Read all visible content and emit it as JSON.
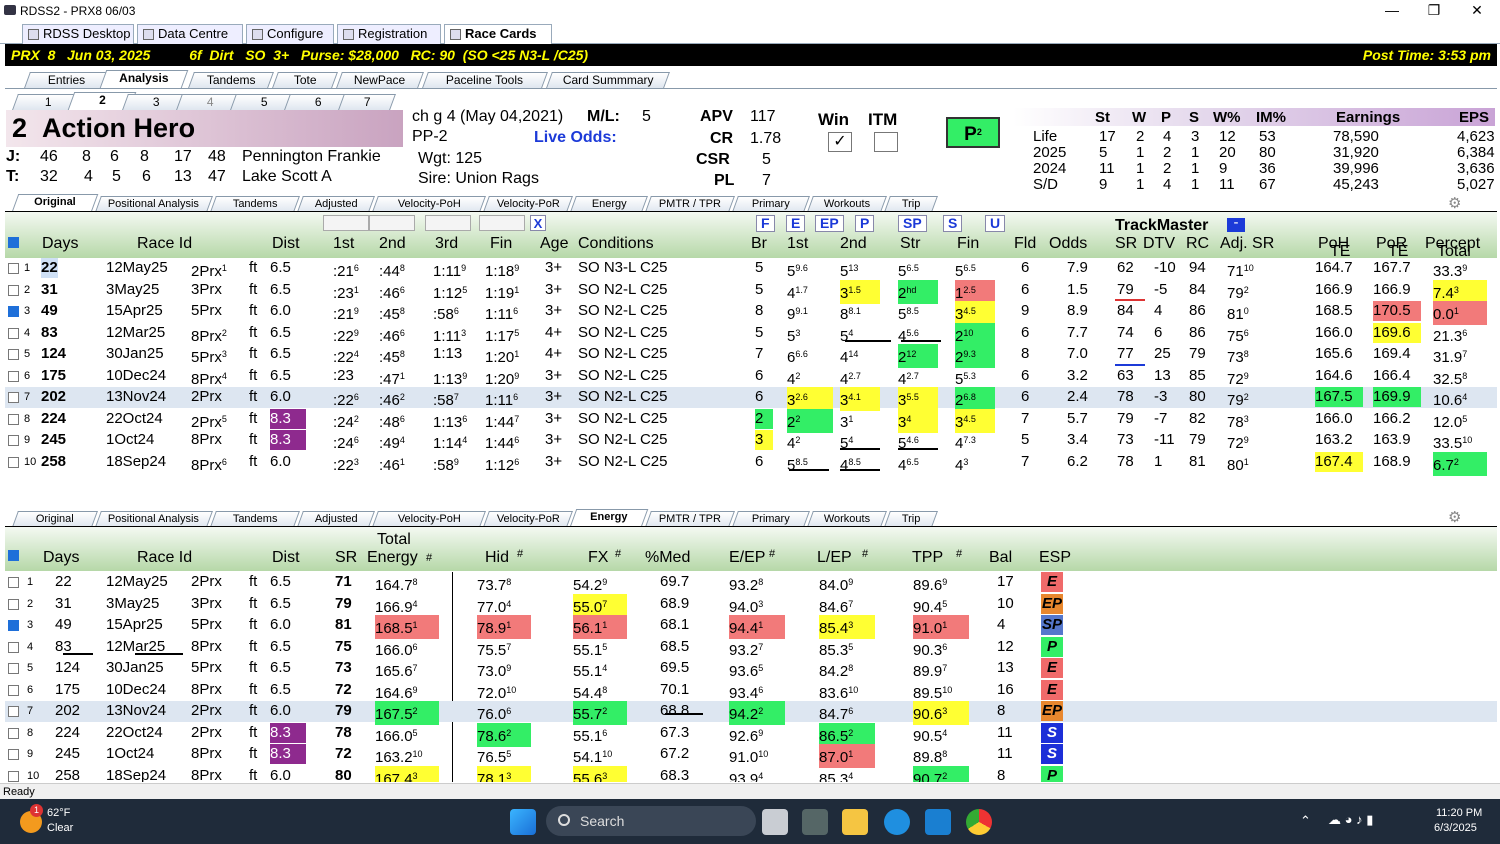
{
  "window": {
    "title": "RDSS2 - PRX8  06/03"
  },
  "apptabs": [
    "RDSS Desktop",
    "Data Centre",
    "Configure",
    "Registration",
    "Race Cards"
  ],
  "race": {
    "left": "PRX  8   Jun 03, 2025          6f  Dirt   SO  3+   Purse: $28,000   RC: 90  (SO <25 N3-L /C25)",
    "right": "Post Time: 3:53 pm"
  },
  "subtabs": [
    "Entries",
    "Analysis",
    "Tandems",
    "Tote",
    "NewPace",
    "Paceline Tools",
    "Card Summmary"
  ],
  "horsetabs": [
    "1",
    "2",
    "3",
    "4",
    "5",
    "6",
    "7"
  ],
  "horse": {
    "num": "2",
    "name": "Action Hero",
    "desc": "ch g 4 (May 04,2021)",
    "pp": "PP-2",
    "wgt": "Wgt: 125",
    "sire": "Sire: Union Rags",
    "ml_label": "M/L:",
    "ml": "5",
    "live": "Live Odds:",
    "j_label": "J:",
    "j": [
      "46",
      "8",
      "6",
      "8",
      "17",
      "48"
    ],
    "jname": "Pennington Frankie",
    "t_label": "T:",
    "t": [
      "32",
      "4",
      "5",
      "6",
      "13",
      "47"
    ],
    "tname": "Lake Scott A",
    "apv_l": "APV",
    "apv": "117",
    "cr_l": "CR",
    "cr": "1.78",
    "csr_l": "CSR",
    "csr": "5",
    "pl_l": "PL",
    "pl": "7",
    "win": "Win",
    "itm": "ITM",
    "badge": "P",
    "badge_sup": "2"
  },
  "career": {
    "headers": [
      "St",
      "W",
      "P",
      "S",
      "W%",
      "IM%",
      "Earnings",
      "EPS"
    ],
    "rows": [
      [
        "Life",
        "17",
        "2",
        "4",
        "3",
        "12",
        "53",
        "78,590",
        "4,623"
      ],
      [
        "2025",
        "5",
        "1",
        "2",
        "1",
        "20",
        "80",
        "31,920",
        "6,384"
      ],
      [
        "2024",
        "11",
        "1",
        "2",
        "1",
        "9",
        "36",
        "39,996",
        "3,636"
      ],
      [
        "S/D",
        "9",
        "1",
        "4",
        "1",
        "11",
        "67",
        "45,243",
        "5,027"
      ]
    ]
  },
  "tabs1": [
    "Original",
    "Positional Analysis",
    "Tandems",
    "Adjusted",
    "Velocity-PoH",
    "Velocity-PoR",
    "Energy",
    "PMTR / TPR",
    "Primary",
    "Workouts",
    "Trip"
  ],
  "grid1": {
    "headers": {
      "days": "Days",
      "race": "Race Id",
      "dist": "Dist",
      "c1": "1st",
      "c2": "2nd",
      "c3": "3rd",
      "fin": "Fin",
      "age": "Age",
      "cond": "Conditions",
      "br": "Br",
      "p1": "1st",
      "p2": "2nd",
      "str": "Str",
      "pfin": "Fin",
      "fld": "Fld",
      "odds": "Odds",
      "tm": "TrackMaster",
      "sr": "SR",
      "dtv": "DTV",
      "rc": "RC",
      "adj": "Adj. SR",
      "poh": "PoH",
      "poh2": "TE",
      "por": "PoR",
      "por2": "TE",
      "pct": "Percept",
      "pct2": "Total",
      "x": "X",
      "pace": [
        "F",
        "E",
        "EP",
        "P",
        "SP",
        "S",
        "U"
      ]
    },
    "rows": [
      [
        "1",
        "22",
        "12May25",
        "2Prx",
        "1",
        "ft",
        "6.5",
        ":21",
        "6",
        ":44",
        "8",
        "1:11",
        "9",
        "1:18",
        "9",
        "3+",
        "SO N3-L C25",
        "5",
        "5",
        "9.6",
        "5",
        "13",
        "5",
        "6.5",
        "5",
        "6.5",
        "6",
        "7.9",
        "62",
        "-10",
        "94",
        "71",
        "10",
        "164.7",
        "167.7",
        "33.3",
        "9"
      ],
      [
        "2",
        "31",
        "3May25",
        "3Prx",
        "",
        "ft",
        "6.5",
        ":23",
        "1",
        ":46",
        "6",
        "1:12",
        "5",
        "1:19",
        "1",
        "3+",
        "SO N2-L C25",
        "5",
        "4",
        "1.7",
        "3",
        "1.5",
        "2",
        "hd",
        "1",
        "2.5",
        "6",
        "1.5",
        "79",
        "-5",
        "84",
        "79",
        "2",
        "166.9",
        "166.9",
        "7.4",
        "3"
      ],
      [
        "3",
        "49",
        "15Apr25",
        "5Prx",
        "",
        "ft",
        "6.0",
        ":21",
        "9",
        ":45",
        "8",
        ":58",
        "6",
        "1:11",
        "6",
        "3+",
        "SO N2-L C25",
        "8",
        "9",
        "9.1",
        "8",
        "8.1",
        "5",
        "8.5",
        "3",
        "4.5",
        "9",
        "8.9",
        "84",
        "4",
        "86",
        "81",
        "0",
        "168.5",
        "170.5",
        "0.0",
        "1"
      ],
      [
        "4",
        "83",
        "12Mar25",
        "8Prx",
        "2",
        "ft",
        "6.5",
        ":22",
        "9",
        ":46",
        "6",
        "1:11",
        "3",
        "1:17",
        "5",
        "4+",
        "SO N2-L C25",
        "5",
        "5",
        "3",
        "5",
        "4",
        "4",
        "5.6",
        "2",
        "10",
        "6",
        "7.7",
        "74",
        "6",
        "86",
        "75",
        "6",
        "166.0",
        "169.6",
        "21.3",
        "6"
      ],
      [
        "5",
        "124",
        "30Jan25",
        "5Prx",
        "3",
        "ft",
        "6.5",
        ":22",
        "4",
        ":45",
        "8",
        "1:13",
        "",
        "1:20",
        "1",
        "4+",
        "SO N2-L C25",
        "7",
        "6",
        "6.6",
        "4",
        "14",
        "2",
        "12",
        "2",
        "9.3",
        "8",
        "7.0",
        "77",
        "25",
        "79",
        "73",
        "8",
        "165.6",
        "169.4",
        "31.9",
        "7"
      ],
      [
        "6",
        "175",
        "10Dec24",
        "8Prx",
        "4",
        "ft",
        "6.5",
        ":23",
        "",
        ":47",
        "1",
        "1:13",
        "9",
        "1:20",
        "9",
        "3+",
        "SO N2-L C25",
        "6",
        "4",
        "2",
        "4",
        "2.7",
        "4",
        "2.7",
        "5",
        "5.3",
        "6",
        "3.2",
        "63",
        "13",
        "85",
        "72",
        "9",
        "164.6",
        "166.4",
        "32.5",
        "8"
      ],
      [
        "7",
        "202",
        "13Nov24",
        "2Prx",
        "",
        "ft",
        "6.0",
        ":22",
        "6",
        ":46",
        "2",
        ":58",
        "7",
        "1:11",
        "6",
        "3+",
        "SO N2-L C25",
        "6",
        "3",
        "2.6",
        "3",
        "4.1",
        "3",
        "5.5",
        "2",
        "6.8",
        "6",
        "2.4",
        "78",
        "-3",
        "80",
        "79",
        "2",
        "167.5",
        "169.9",
        "10.6",
        "4"
      ],
      [
        "8",
        "224",
        "22Oct24",
        "2Prx",
        "5",
        "ft",
        "8.3",
        ":24",
        "2",
        ":48",
        "6",
        "1:13",
        "6",
        "1:44",
        "7",
        "3+",
        "SO N2-L C25",
        "2",
        "2",
        "2",
        "3",
        "1",
        "3",
        "4",
        "3",
        "4.5",
        "7",
        "5.7",
        "79",
        "-7",
        "82",
        "78",
        "3",
        "166.0",
        "166.2",
        "12.0",
        "5"
      ],
      [
        "9",
        "245",
        "1Oct24",
        "8Prx",
        "",
        "ft",
        "8.3",
        ":24",
        "6",
        ":49",
        "4",
        "1:14",
        "4",
        "1:44",
        "6",
        "3+",
        "SO N2-L C25",
        "3",
        "4",
        "2",
        "5",
        "4",
        "5",
        "4.6",
        "4",
        "7.3",
        "5",
        "3.4",
        "73",
        "-11",
        "79",
        "72",
        "9",
        "163.2",
        "163.9",
        "33.5",
        "10"
      ],
      [
        "10",
        "258",
        "18Sep24",
        "8Prx",
        "6",
        "ft",
        "6.0",
        ":22",
        "3",
        ":46",
        "1",
        ":58",
        "9",
        "1:12",
        "6",
        "3+",
        "SO N2-L C25",
        "6",
        "5",
        "8.5",
        "4",
        "8.5",
        "4",
        "6.5",
        "4",
        "3",
        "7",
        "6.2",
        "78",
        "1",
        "81",
        "80",
        "1",
        "167.4",
        "168.9",
        "6.7",
        "2"
      ]
    ]
  },
  "tabs2": [
    "Original",
    "Positional Analysis",
    "Tandems",
    "Adjusted",
    "Velocity-PoH",
    "Velocity-PoR",
    "Energy",
    "PMTR / TPR",
    "Primary",
    "Workouts",
    "Trip"
  ],
  "grid2": {
    "headers": {
      "days": "Days",
      "race": "Race Id",
      "dist": "Dist",
      "sr": "SR",
      "te1": "Total",
      "te2": "Energy",
      "hash": "#",
      "hid": "Hid",
      "fx": "FX",
      "med": "%Med",
      "eep": "E/EP",
      "lep": "L/EP",
      "tpp": "TPP",
      "bal": "Bal",
      "esp": "ESP"
    },
    "rows": [
      [
        "1",
        "22",
        "12May25",
        "2Prx",
        "ft",
        "6.5",
        "71",
        "164.7",
        "8",
        "73.7",
        "8",
        "54.2",
        "9",
        "69.7",
        "93.2",
        "8",
        "84.0",
        "9",
        "89.6",
        "9",
        "17",
        "E"
      ],
      [
        "2",
        "31",
        "3May25",
        "3Prx",
        "ft",
        "6.5",
        "79",
        "166.9",
        "4",
        "77.0",
        "4",
        "55.0",
        "7",
        "68.9",
        "94.0",
        "3",
        "84.6",
        "7",
        "90.4",
        "5",
        "10",
        "EP"
      ],
      [
        "3",
        "49",
        "15Apr25",
        "5Prx",
        "ft",
        "6.0",
        "81",
        "168.5",
        "1",
        "78.9",
        "1",
        "56.1",
        "1",
        "68.1",
        "94.4",
        "1",
        "85.4",
        "3",
        "91.0",
        "1",
        "4",
        "SP"
      ],
      [
        "4",
        "83",
        "12Mar25",
        "8Prx",
        "ft",
        "6.5",
        "75",
        "166.0",
        "6",
        "75.5",
        "7",
        "55.1",
        "5",
        "68.5",
        "93.2",
        "7",
        "85.3",
        "5",
        "90.3",
        "6",
        "12",
        "P"
      ],
      [
        "5",
        "124",
        "30Jan25",
        "5Prx",
        "ft",
        "6.5",
        "73",
        "165.6",
        "7",
        "73.0",
        "9",
        "55.1",
        "4",
        "69.5",
        "93.6",
        "5",
        "84.2",
        "8",
        "89.9",
        "7",
        "13",
        "E"
      ],
      [
        "6",
        "175",
        "10Dec24",
        "8Prx",
        "ft",
        "6.5",
        "72",
        "164.6",
        "9",
        "72.0",
        "10",
        "54.4",
        "8",
        "70.1",
        "93.4",
        "6",
        "83.6",
        "10",
        "89.5",
        "10",
        "16",
        "E"
      ],
      [
        "7",
        "202",
        "13Nov24",
        "2Prx",
        "ft",
        "6.0",
        "79",
        "167.5",
        "2",
        "76.0",
        "6",
        "55.7",
        "2",
        "68.8",
        "94.2",
        "2",
        "84.7",
        "6",
        "90.6",
        "3",
        "8",
        "EP"
      ],
      [
        "8",
        "224",
        "22Oct24",
        "2Prx",
        "ft",
        "8.3",
        "78",
        "166.0",
        "5",
        "78.6",
        "2",
        "55.1",
        "6",
        "67.3",
        "92.6",
        "9",
        "86.5",
        "2",
        "90.5",
        "4",
        "11",
        "S"
      ],
      [
        "9",
        "245",
        "1Oct24",
        "8Prx",
        "ft",
        "8.3",
        "72",
        "163.2",
        "10",
        "76.5",
        "5",
        "54.1",
        "10",
        "67.2",
        "91.0",
        "10",
        "87.0",
        "1",
        "89.8",
        "8",
        "11",
        "S"
      ],
      [
        "10",
        "258",
        "18Sep24",
        "8Prx",
        "ft",
        "6.0",
        "80",
        "167.4",
        "3",
        "78.1",
        "3",
        "55.6",
        "3",
        "68.3",
        "93.9",
        "4",
        "85.3",
        "4",
        "90.7",
        "2",
        "8",
        "P"
      ]
    ]
  },
  "status": "Ready",
  "taskbar": {
    "temp": "62°F",
    "weather": "Clear",
    "search": "Search",
    "time": "11:20 PM",
    "date": "6/3/2025",
    "notif": "1"
  }
}
